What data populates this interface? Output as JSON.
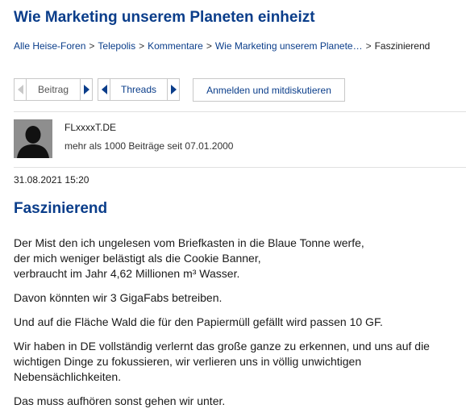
{
  "page_title": "Wie Marketing unserem Planeten einheizt",
  "breadcrumb": {
    "items": [
      "Alle Heise-Foren",
      "Telepolis",
      "Kommentare",
      "Wie Marketing unserem Planete…"
    ],
    "separator": ">",
    "current": "Faszinierend"
  },
  "nav": {
    "post_label": "Beitrag",
    "threads_label": "Threads",
    "login_label": "Anmelden und mitdiskutieren"
  },
  "author": {
    "name": "FLxxxxT.DE",
    "stats": "mehr als 1000 Beiträge seit 07.01.2000"
  },
  "post": {
    "date": "31.08.2021 15:20",
    "title": "Faszinierend",
    "paragraphs": [
      [
        "Der Mist den ich ungelesen vom Briefkasten in die Blaue Tonne werfe,",
        "der mich weniger belästigt als die Cookie Banner,",
        "verbraucht im Jahr 4,62 Millionen m³ Wasser."
      ],
      [
        "Davon könnten wir 3 GigaFabs betreiben."
      ],
      [
        "Und auf die Fläche Wald die für den Papiermüll gefällt wird passen 10 GF."
      ],
      [
        "Wir haben in DE vollständig verlernt das große ganze zu erkennen, und uns auf die",
        "wichtigen Dinge zu fokussieren, wir verlieren uns in völlig unwichtigen",
        "Nebensächlichkeiten."
      ],
      [
        "Das muss aufhören sonst gehen wir unter."
      ]
    ]
  },
  "colors": {
    "accent": "#0a3d8a",
    "border": "#c8c8c8"
  }
}
